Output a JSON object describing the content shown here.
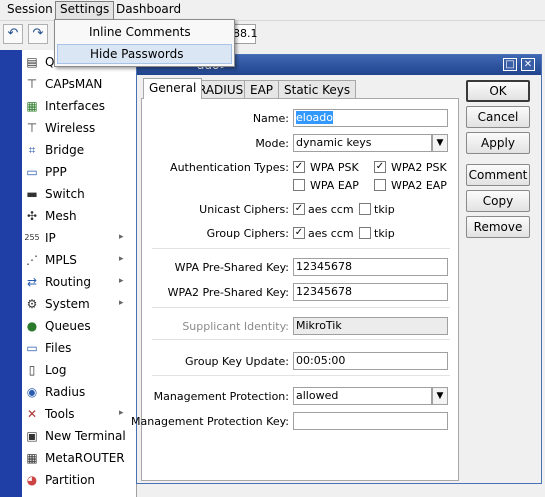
{
  "menubar": {
    "items": [
      "Session",
      "Settings",
      "Dashboard"
    ]
  },
  "dropdown": {
    "items": [
      "Inline Comments",
      "Hide Passwords"
    ]
  },
  "toolbar": {
    "undo_icon": "undo-icon",
    "redo_icon": "redo-icon",
    "address_fragment": "88.1"
  },
  "sidebar": {
    "items": [
      {
        "label": "Q",
        "icon": "quick-set-icon",
        "arrow": false
      },
      {
        "label": "CAPsMAN",
        "icon": "antenna-icon",
        "arrow": false
      },
      {
        "label": "Interfaces",
        "icon": "interfaces-icon",
        "arrow": false
      },
      {
        "label": "Wireless",
        "icon": "wireless-icon",
        "arrow": false
      },
      {
        "label": "Bridge",
        "icon": "bridge-icon",
        "arrow": false
      },
      {
        "label": "PPP",
        "icon": "ppp-icon",
        "arrow": false
      },
      {
        "label": "Switch",
        "icon": "switch-icon",
        "arrow": false
      },
      {
        "label": "Mesh",
        "icon": "mesh-icon",
        "arrow": false
      },
      {
        "label": "IP",
        "icon": "ip-icon",
        "arrow": true
      },
      {
        "label": "MPLS",
        "icon": "mpls-icon",
        "arrow": true
      },
      {
        "label": "Routing",
        "icon": "routing-icon",
        "arrow": true
      },
      {
        "label": "System",
        "icon": "gear-icon",
        "arrow": true
      },
      {
        "label": "Queues",
        "icon": "queues-icon",
        "arrow": false
      },
      {
        "label": "Files",
        "icon": "folder-icon",
        "arrow": false
      },
      {
        "label": "Log",
        "icon": "log-icon",
        "arrow": false
      },
      {
        "label": "Radius",
        "icon": "radius-icon",
        "arrow": false
      },
      {
        "label": "Tools",
        "icon": "tools-icon",
        "arrow": true
      },
      {
        "label": "New Terminal",
        "icon": "terminal-icon",
        "arrow": false
      },
      {
        "label": "MetaROUTER",
        "icon": "metarouter-icon",
        "arrow": false
      },
      {
        "label": "Partition",
        "icon": "partition-icon",
        "arrow": false
      }
    ]
  },
  "dialog": {
    "title": "ado>",
    "tabs": [
      "General",
      "RADIUS",
      "EAP",
      "Static Keys"
    ],
    "active_tab": "General",
    "fields": {
      "name": {
        "label": "Name:",
        "value": "eloado"
      },
      "mode": {
        "label": "Mode:",
        "value": "dynamic keys"
      },
      "auth_types": {
        "label": "Authentication Types:",
        "options": [
          {
            "label": "WPA PSK",
            "checked": true
          },
          {
            "label": "WPA2 PSK",
            "checked": true
          },
          {
            "label": "WPA EAP",
            "checked": false
          },
          {
            "label": "WPA2 EAP",
            "checked": false
          }
        ]
      },
      "unicast_ciphers": {
        "label": "Unicast Ciphers:",
        "options": [
          {
            "label": "aes ccm",
            "checked": true
          },
          {
            "label": "tkip",
            "checked": false
          }
        ]
      },
      "group_ciphers": {
        "label": "Group Ciphers:",
        "options": [
          {
            "label": "aes ccm",
            "checked": true
          },
          {
            "label": "tkip",
            "checked": false
          }
        ]
      },
      "wpa_psk": {
        "label": "WPA Pre-Shared Key:",
        "value": "12345678"
      },
      "wpa2_psk": {
        "label": "WPA2 Pre-Shared Key:",
        "value": "12345678"
      },
      "supplicant_identity": {
        "label": "Supplicant Identity:",
        "value": "MikroTik"
      },
      "group_key_update": {
        "label": "Group Key Update:",
        "value": "00:05:00"
      },
      "mgmt_protection": {
        "label": "Management Protection:",
        "value": "allowed"
      },
      "mgmt_protection_key": {
        "label": "Management Protection Key:",
        "value": ""
      }
    },
    "buttons": [
      "OK",
      "Cancel",
      "Apply",
      "Comment",
      "Copy",
      "Remove"
    ]
  },
  "colors": {
    "sidebar_strip": "#1f3fa6",
    "titlebar": "#2f55a0",
    "selection": "#3399ff",
    "dropdown_hover": "#dbe6f4"
  }
}
